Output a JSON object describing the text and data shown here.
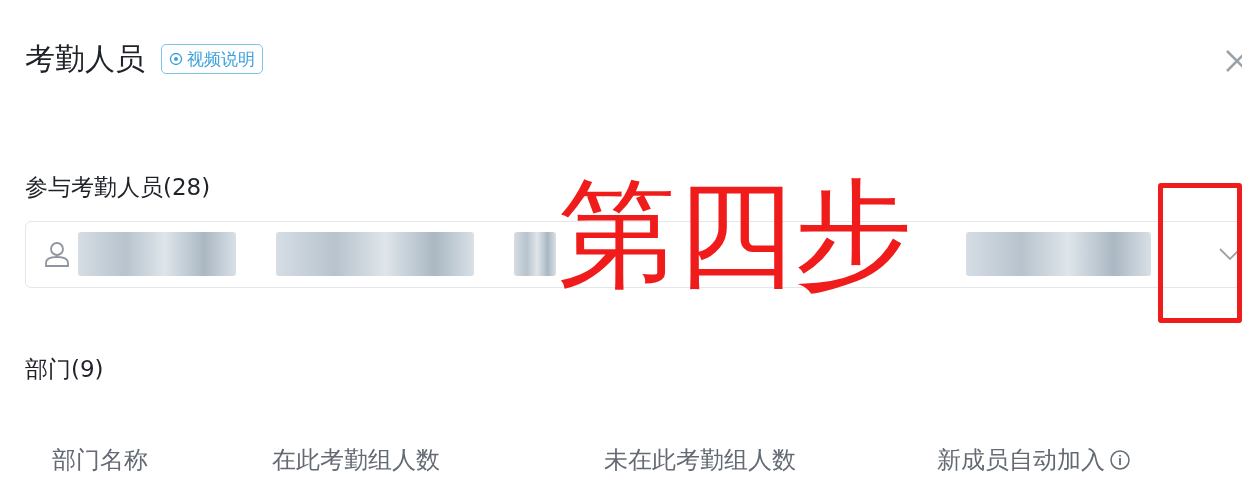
{
  "dialog": {
    "title": "考勤人员",
    "video_button": "视频说明"
  },
  "participants": {
    "label": "参与考勤人员(28)",
    "members": [
      {
        "kind": "redacted"
      },
      {
        "kind": "redacted"
      },
      {
        "kind": "redacted"
      },
      {
        "kind": "redacted"
      }
    ]
  },
  "departments": {
    "label": "部门(9)",
    "columns": [
      "部门名称",
      "在此考勤组人数",
      "未在此考勤组人数",
      "新成员自动加入"
    ]
  },
  "annotation": {
    "text": "第四步"
  }
}
